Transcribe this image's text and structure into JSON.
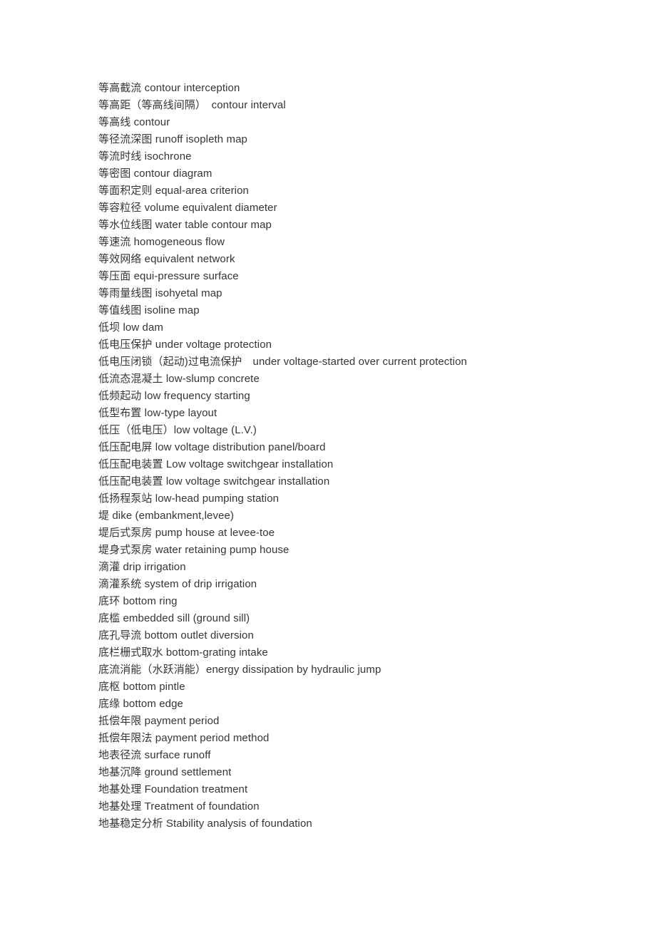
{
  "document": {
    "type": "glossary",
    "page_background": "#ffffff",
    "text_color": "#363636",
    "entries": [
      {
        "text": "等高截流 contour interception"
      },
      {
        "text": "等高距（等高线间隔）　contour interval"
      },
      {
        "text": "等高线 contour"
      },
      {
        "text": "等径流深图 runoff isopleth map"
      },
      {
        "text": "等流时线 isochrone"
      },
      {
        "text": "等密图 contour diagram"
      },
      {
        "text": "等面积定则 equal-area criterion"
      },
      {
        "text": "等容粒径 volume equivalent diameter"
      },
      {
        "text": "等水位线图 water table contour map"
      },
      {
        "text": "等速流 homogeneous flow"
      },
      {
        "text": "等效网络 equivalent network"
      },
      {
        "text": "等压面 equi-pressure surface"
      },
      {
        "text": "等雨量线图 isohyetal map"
      },
      {
        "text": "等值线图 isoline map"
      },
      {
        "text": "低坝 low dam"
      },
      {
        "text": "低电压保护 under voltage protection"
      },
      {
        "text": "低电压闭锁（起动)过电流保护　under voltage-started over current protection"
      },
      {
        "text": "低流态混凝土 low-slump concrete"
      },
      {
        "text": "低频起动 low frequency starting"
      },
      {
        "text": "低型布置 low-type layout"
      },
      {
        "text": "低压（低电压）low voltage (L.V.)"
      },
      {
        "text": "低压配电屏 low voltage distribution panel/board"
      },
      {
        "text": "低压配电装置 Low voltage switchgear installation"
      },
      {
        "text": "低压配电装置 low voltage switchgear installation"
      },
      {
        "text": "低扬程泵站 low-head pumping station"
      },
      {
        "text": "堤 dike (embankment,levee)"
      },
      {
        "text": "堤后式泵房 pump house at levee-toe"
      },
      {
        "text": "堤身式泵房 water retaining pump house"
      },
      {
        "text": "滴灌 drip irrigation"
      },
      {
        "text": "滴灌系统 system of drip irrigation"
      },
      {
        "text": "底环 bottom ring"
      },
      {
        "text": "底槛 embedded sill (ground sill)"
      },
      {
        "text": "底孔导流 bottom outlet diversion"
      },
      {
        "text": "底栏栅式取水 bottom-grating intake"
      },
      {
        "text": "底流消能（水跃消能）energy dissipation by hydraulic jump"
      },
      {
        "text": "底枢 bottom pintle"
      },
      {
        "text": "底缘 bottom edge"
      },
      {
        "text": "抵偿年限 payment period"
      },
      {
        "text": "抵偿年限法 payment period method"
      },
      {
        "text": "地表径流 surface runoff"
      },
      {
        "text": "地基沉降 ground settlement"
      },
      {
        "text": "地基处理 Foundation treatment"
      },
      {
        "text": "地基处理 Treatment of foundation"
      },
      {
        "text": "地基稳定分析 Stability analysis of foundation"
      }
    ]
  }
}
